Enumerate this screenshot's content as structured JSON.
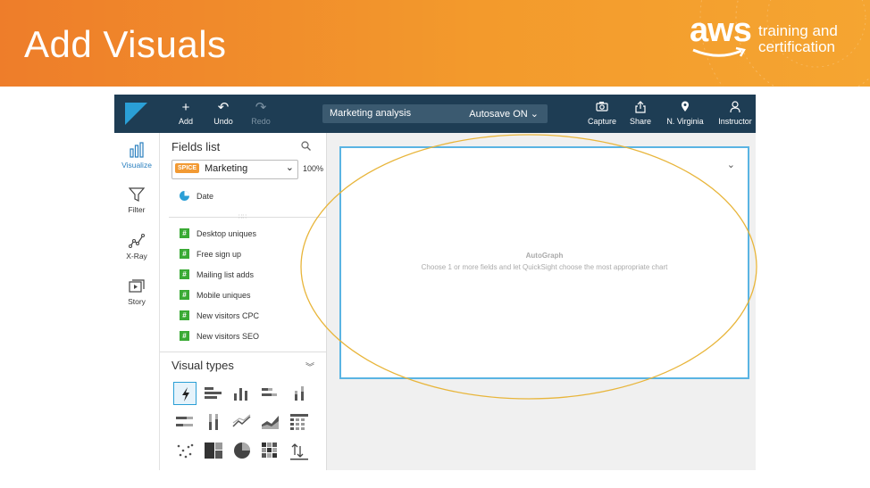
{
  "slide": {
    "title": "Add Visuals",
    "brand": {
      "word": "aws",
      "tagline_line1": "training and",
      "tagline_line2": "certification"
    }
  },
  "toolbar": {
    "add_label": "Add",
    "undo_label": "Undo",
    "redo_label": "Redo",
    "analysis_name": "Marketing analysis",
    "autosave_label": "Autosave ON",
    "capture_label": "Capture",
    "share_label": "Share",
    "region_label": "N. Virginia",
    "user_label": "Instructor"
  },
  "leftnav": {
    "items": [
      {
        "label": "Visualize",
        "icon": "bar-chart-icon"
      },
      {
        "label": "Filter",
        "icon": "funnel-icon"
      },
      {
        "label": "X-Ray",
        "icon": "xray-icon"
      },
      {
        "label": "Story",
        "icon": "story-icon"
      }
    ]
  },
  "fields_panel": {
    "title": "Fields list",
    "dataset_badge": "SPICE",
    "dataset_name": "Marketing",
    "spice_usage": "100%",
    "dimensions": [
      {
        "label": "Date",
        "type": "date"
      }
    ],
    "measures": [
      {
        "label": "Desktop uniques",
        "type": "#"
      },
      {
        "label": "Free sign up",
        "type": "#"
      },
      {
        "label": "Mailing list adds",
        "type": "#"
      },
      {
        "label": "Mobile uniques",
        "type": "#"
      },
      {
        "label": "New visitors CPC",
        "type": "#"
      },
      {
        "label": "New visitors SEO",
        "type": "#"
      }
    ]
  },
  "visual_types": {
    "title": "Visual types",
    "selected": "autograph",
    "items": [
      "autograph",
      "horizontal-bar",
      "vertical-bar",
      "horizontal-stacked-bar",
      "vertical-stacked-bar",
      "horizontal-100-bar",
      "vertical-100-bar",
      "line",
      "area-line",
      "pivot-table",
      "scatter",
      "tree-map",
      "pie",
      "heat-map",
      "kpi"
    ]
  },
  "visual": {
    "heading": "AutoGraph",
    "hint": "Choose 1 or more fields and let QuickSight choose the most appropriate chart"
  },
  "colors": {
    "banner": "#f39a2c",
    "topbar": "#1e3d54",
    "accent": "#2a9fd6",
    "measure": "#3aaa35",
    "spice": "#f29a33",
    "highlight_ellipse": "#e8b53a"
  }
}
